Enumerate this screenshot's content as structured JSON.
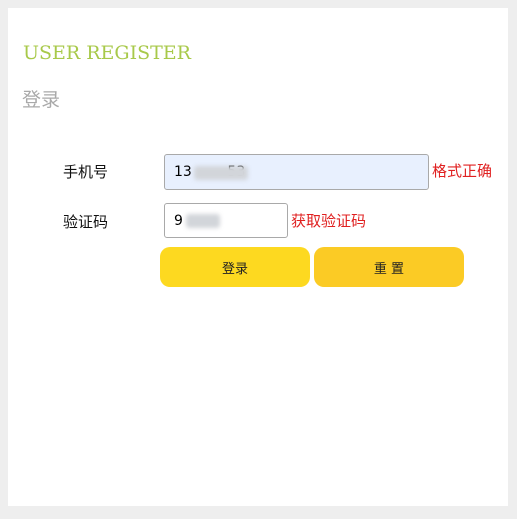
{
  "header": {
    "title": "USER REGISTER",
    "subtitle": "登录"
  },
  "form": {
    "phone_label": "手机号",
    "phone_value": "13        53",
    "phone_status": "格式正确",
    "code_label": "验证码",
    "code_value": "9",
    "get_code_link": "获取验证码"
  },
  "buttons": {
    "login": "登录",
    "reset": "重 置"
  },
  "colors": {
    "heading": "#a8c94a",
    "subtitle": "#a9a9a9",
    "status_red": "#e02020",
    "login_button": "#fdd920",
    "reset_button": "#fbcb25",
    "phone_input_bg": "#e8f0fe"
  }
}
